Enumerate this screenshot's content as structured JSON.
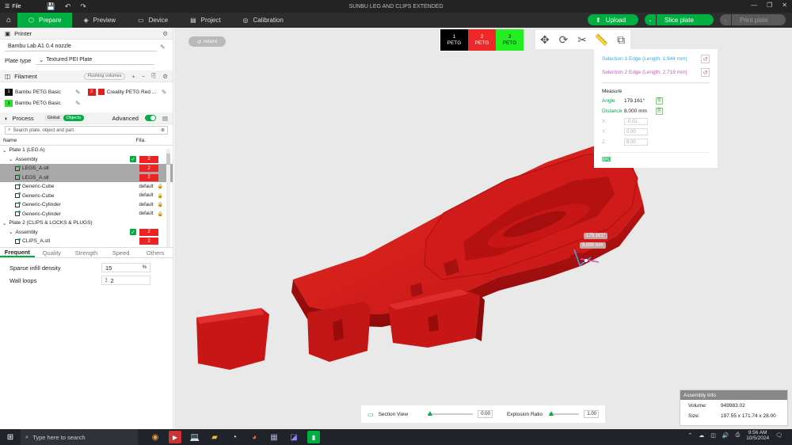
{
  "titlebar": {
    "file_menu": "File",
    "window_title": "SUNBU LEG AND CLIPS EXTENDED"
  },
  "nav": {
    "tabs": [
      {
        "label": "Prepare",
        "icon": "cube-icon"
      },
      {
        "label": "Preview",
        "icon": "layers-icon"
      },
      {
        "label": "Device",
        "icon": "monitor-icon"
      },
      {
        "label": "Project",
        "icon": "project-icon"
      },
      {
        "label": "Calibration",
        "icon": "calibration-icon"
      }
    ],
    "upload": "Upload",
    "slice_plate": "Slice plate",
    "print_plate": "Print plate"
  },
  "printer": {
    "section_title": "Printer",
    "printer_name": "Bambu Lab A1 0.4 nozzle",
    "plate_type_label": "Plate type",
    "plate_type_value": "Textured PEI Plate"
  },
  "filament": {
    "section_title": "Filament",
    "flushing_volumes": "Flushing volumes",
    "items": [
      {
        "index": "1",
        "color": "#111111",
        "name": "Bambu PETG Basic"
      },
      {
        "index": "2",
        "color": "#e02020",
        "name": "Creality PETG Red ..."
      },
      {
        "index": "3",
        "color": "#2ee02e",
        "name": "Bambu PETG Basic"
      }
    ]
  },
  "process": {
    "section_title": "Process",
    "toggle_global": "Global",
    "toggle_objects": "Objects",
    "advanced_label": "Advanced",
    "search_placeholder": "Search plate, object and part.",
    "col_name": "Name",
    "col_fila": "Fila.",
    "tree": [
      {
        "label": "Plate 1 (LEG A)",
        "level": 0
      },
      {
        "label": "Assembly",
        "level": 1,
        "check": true,
        "fila": "2"
      },
      {
        "label": "LEGS_A.stl",
        "level": 2,
        "fila": "2",
        "selected": true
      },
      {
        "label": "LEGS_A.stl",
        "level": 2,
        "fila": "2",
        "selected": true
      },
      {
        "label": "Generic-Cube",
        "level": 2,
        "def": "default",
        "lock": true
      },
      {
        "label": "Generic-Cube",
        "level": 2,
        "def": "default",
        "lock": true
      },
      {
        "label": "Generic-Cylinder",
        "level": 2,
        "def": "default",
        "lock": true
      },
      {
        "label": "Generic-Cylinder",
        "level": 2,
        "def": "default",
        "lock": true
      },
      {
        "label": "Plate 2 (CLIPS & LOCKS & PLUGS)",
        "level": 0
      },
      {
        "label": "Assembly",
        "level": 1,
        "check": true,
        "fila": "2"
      },
      {
        "label": "CLIPS_A.stl",
        "level": 2,
        "fila": "2"
      }
    ],
    "param_tabs": [
      "Frequent",
      "Quality",
      "Strength",
      "Speed",
      "Others"
    ],
    "params": [
      {
        "label": "Sparse infill density",
        "value": "15",
        "unit": "%"
      },
      {
        "label": "Wall loops",
        "value": "2",
        "unit": ""
      }
    ]
  },
  "viewport": {
    "return_label": "return",
    "filament_buttons": [
      {
        "num": "1",
        "label": "PETG",
        "color": "#000000",
        "text_color": "#ffffff"
      },
      {
        "num": "2",
        "label": "PETG",
        "color": "#ee2828",
        "text_color": "#ffffff"
      },
      {
        "num": "3",
        "label": "PETG",
        "color": "#22ee22",
        "text_color": "#111111"
      }
    ],
    "measure": {
      "selection1": "Selection 1  Edge (Length: 1.944 mm)",
      "selection2": "Selection 2  Edge (Length: 2.719 mm)",
      "title": "Measure",
      "angle_label": "Angle",
      "angle_value": "179.161°",
      "distance_label": "Distance",
      "distance_value": "8.000 mm",
      "x_label": "X:",
      "x_value": "-0.01",
      "y_label": "Y:",
      "y_value": "0.00",
      "z_label": "Z:",
      "z_value": "8.00"
    },
    "tag_angle": "179.161°",
    "tag_distance": "8.000 mm",
    "model_color": "#d81818",
    "section_view_label": "Section View",
    "section_view_value": "0.00",
    "explosion_label": "Explosion Ratio",
    "explosion_value": "1.00",
    "assembly_info": {
      "title": "Assembly Info",
      "volume_label": "Volume:",
      "volume_value": "949983.02",
      "size_label": "Size:",
      "size_value": "197.55 x 171.74 x 28.00"
    }
  },
  "taskbar": {
    "search_placeholder": "Type here to search",
    "time": "9:56 AM",
    "date": "10/5/2024"
  }
}
